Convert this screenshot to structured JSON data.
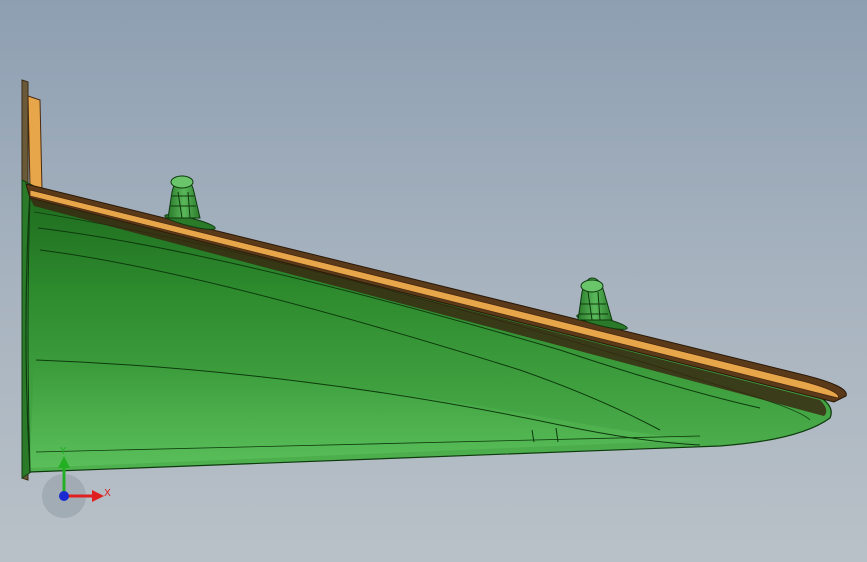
{
  "viewport": {
    "background_top": "#8e9fb2",
    "background_bottom": "#b9c1c8"
  },
  "model": {
    "body_color": "#2f8a2f",
    "body_dark": "#1b5e1b",
    "flange_color": "#e8a64a",
    "edge_color": "#4a2a12",
    "clip_color": "#3c9a3c"
  },
  "triad": {
    "x_label": "X",
    "y_label": "Y",
    "x_color": "#e02020",
    "y_color": "#22b022",
    "origin_color": "#1a2ad0"
  }
}
